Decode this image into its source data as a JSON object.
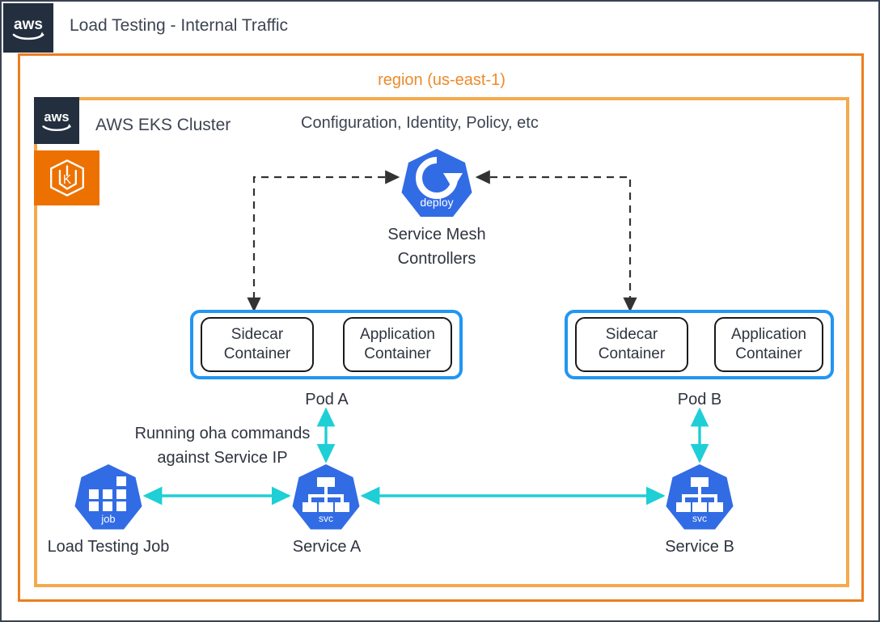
{
  "header": {
    "logo": "aws-logo",
    "title": "Load Testing - Internal Traffic"
  },
  "region": {
    "label": "region (us-east-1)"
  },
  "cluster": {
    "aws_logo": "aws-logo",
    "k8s_logo": "eks-kubernetes-icon",
    "title": "AWS EKS Cluster",
    "note": "Configuration, Identity, Policy, etc"
  },
  "controller": {
    "icon_label": "deploy",
    "caption": "Service Mesh\nControllers"
  },
  "pods": [
    {
      "id": "pod-a",
      "caption": "Pod A",
      "sidecar": "Sidecar\nContainer",
      "application": "Application\nContainer"
    },
    {
      "id": "pod-b",
      "caption": "Pod B",
      "sidecar": "Sidecar\nContainer",
      "application": "Application\nContainer"
    }
  ],
  "nodes": [
    {
      "id": "job",
      "icon_label": "job",
      "caption": "Load Testing Job"
    },
    {
      "id": "service-a",
      "icon_label": "svc",
      "caption": "Service A"
    },
    {
      "id": "service-b",
      "icon_label": "svc",
      "caption": "Service B"
    }
  ],
  "annotations": {
    "oha_note": "Running oha commands\nagainst Service IP"
  },
  "colors": {
    "aws_navy": "#232F3E",
    "region_orange": "#ED7D1F",
    "cluster_orange": "#F5A94E",
    "eks_orange": "#ED7100",
    "pod_blue": "#2196F3",
    "k8s_blue": "#326CE5",
    "traffic_cyan": "#1ECFD6",
    "wire_dark": "#333333",
    "text_dark": "#2f343f"
  }
}
